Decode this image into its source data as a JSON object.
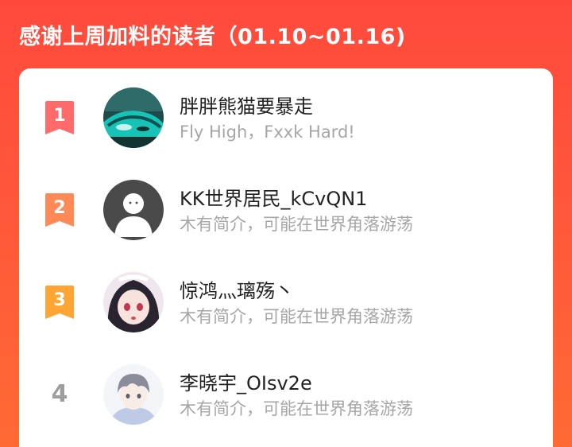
{
  "header": {
    "title": "感谢上周加料的读者（01.10~01.16)"
  },
  "readers": [
    {
      "rank": "1",
      "name": "胖胖熊猫要暴走",
      "bio": "Fly High，Fxxk Hard!",
      "badge_color": "#ff6b6b",
      "avatar": "car-photo-avatar"
    },
    {
      "rank": "2",
      "name": "KK世界居民_kCvQN1",
      "bio": "木有简介，可能在世界角落游荡",
      "badge_color": "#ff8a55",
      "avatar": "default-user-avatar"
    },
    {
      "rank": "3",
      "name": "惊鸿灬璃殇丶",
      "bio": "木有简介，可能在世界角落游荡",
      "badge_color": "#ffa533",
      "avatar": "anime-girl-avatar"
    },
    {
      "rank": "4",
      "name": "李晓宇_OIsv2e",
      "bio": "木有简介，可能在世界角落游荡",
      "badge_color": "#9e9e9e",
      "avatar": "anime-boy-avatar"
    }
  ]
}
